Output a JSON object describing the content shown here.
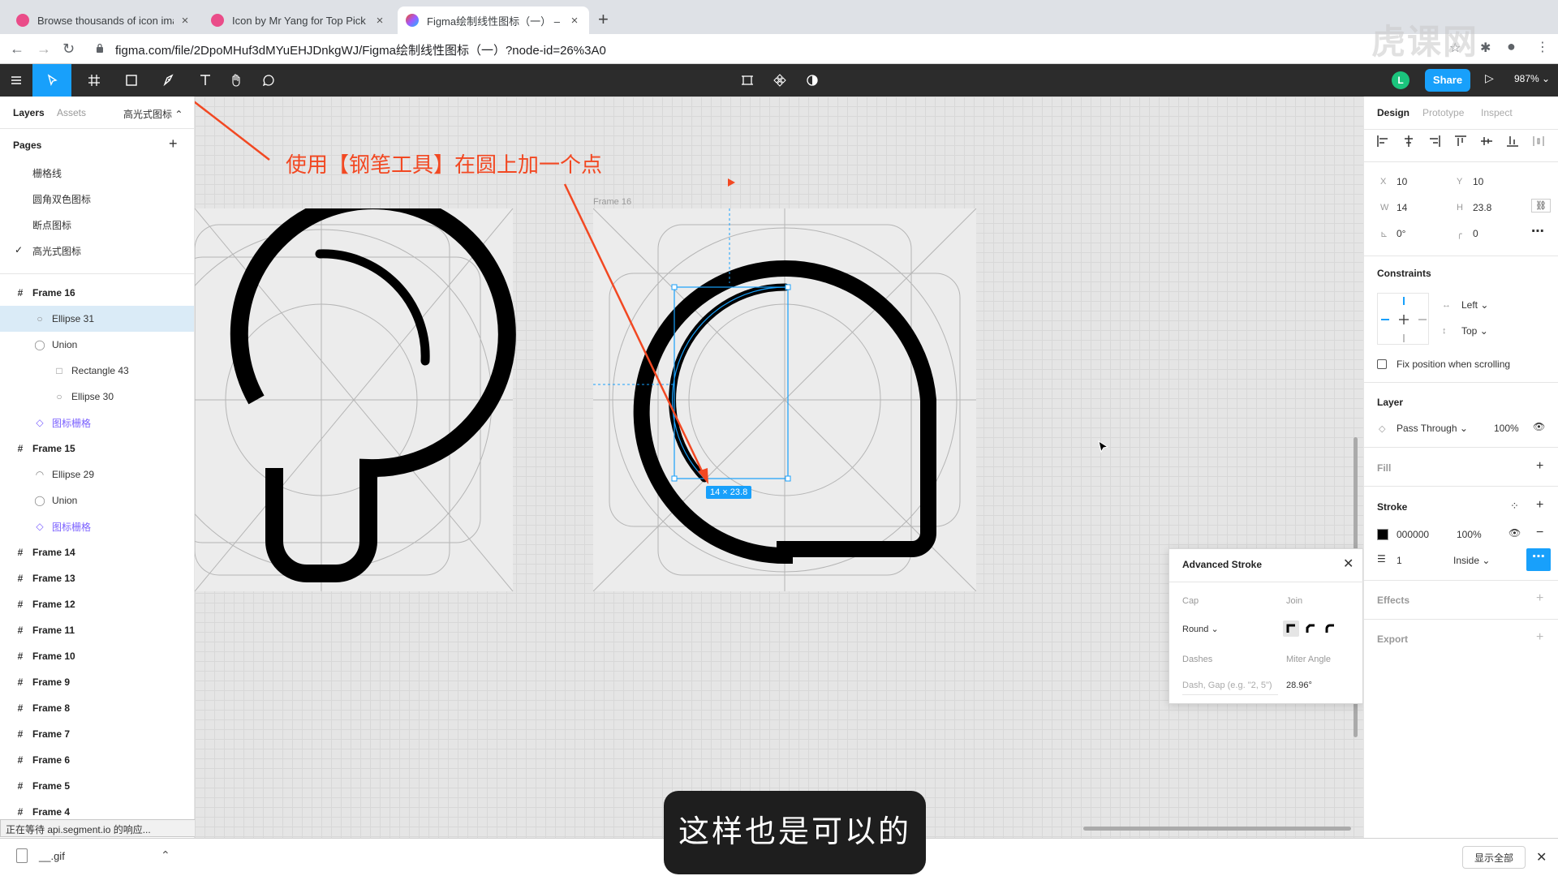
{
  "browser": {
    "tabs": [
      {
        "title": "Browse thousands of icon imag",
        "active": false,
        "favicon_color": "#ea4c89"
      },
      {
        "title": "Icon by Mr Yang for Top Pick S",
        "active": false,
        "favicon_color": "#ea4c89"
      },
      {
        "title": "Figma绘制线性图标（一） – Fig",
        "active": true,
        "favicon_color": "#f24e1e"
      }
    ],
    "url": "figma.com/file/2DpoMHuf3dMYuEHJDnkgWJ/Figma绘制线性图标（一）?node-id=26%3A0",
    "watermark": "虎课网"
  },
  "toolbar": {
    "share_label": "Share",
    "zoom": "987%",
    "avatar_initial": "L"
  },
  "left_panel": {
    "tabs": {
      "layers": "Layers",
      "assets": "Assets"
    },
    "current_page": "高光式图标",
    "pages_header": "Pages",
    "pages": [
      "栅格线",
      "圆角双色图标",
      "断点图标",
      "高光式图标"
    ],
    "layers": [
      {
        "label": "Frame 16",
        "type": "frame",
        "indent": 0
      },
      {
        "label": "Ellipse 31",
        "type": "ellipse",
        "indent": 1,
        "selected": true
      },
      {
        "label": "Union",
        "type": "union",
        "indent": 1
      },
      {
        "label": "Rectangle 43",
        "type": "rect",
        "indent": 2
      },
      {
        "label": "Ellipse 30",
        "type": "ellipse",
        "indent": 2
      },
      {
        "label": "图标栅格",
        "type": "component",
        "indent": 1
      },
      {
        "label": "Frame 15",
        "type": "frame",
        "indent": 0
      },
      {
        "label": "Ellipse 29",
        "type": "arc",
        "indent": 1
      },
      {
        "label": "Union",
        "type": "union",
        "indent": 1
      },
      {
        "label": "图标栅格",
        "type": "component",
        "indent": 1
      },
      {
        "label": "Frame 14",
        "type": "frame",
        "indent": 0
      },
      {
        "label": "Frame 13",
        "type": "frame",
        "indent": 0
      },
      {
        "label": "Frame 12",
        "type": "frame",
        "indent": 0
      },
      {
        "label": "Frame 11",
        "type": "frame",
        "indent": 0
      },
      {
        "label": "Frame 10",
        "type": "frame",
        "indent": 0
      },
      {
        "label": "Frame 9",
        "type": "frame",
        "indent": 0
      },
      {
        "label": "Frame 8",
        "type": "frame",
        "indent": 0
      },
      {
        "label": "Frame 7",
        "type": "frame",
        "indent": 0
      },
      {
        "label": "Frame 6",
        "type": "frame",
        "indent": 0
      },
      {
        "label": "Frame 5",
        "type": "frame",
        "indent": 0
      },
      {
        "label": "Frame 4",
        "type": "frame",
        "indent": 0
      }
    ],
    "status_tip": "正在等待 api.segment.io 的响应..."
  },
  "canvas": {
    "frame_label": "Frame 16",
    "annotation": "使用【钢笔工具】在圆上加一个点",
    "annotation_color": "#f24822",
    "dimension_badge": "14 × 23.8"
  },
  "advanced_stroke": {
    "title": "Advanced Stroke",
    "cap_label": "Cap",
    "cap_value": "Round",
    "join_label": "Join",
    "dashes_label": "Dashes",
    "dashes_placeholder": "Dash, Gap (e.g. \"2, 5\")",
    "miter_label": "Miter Angle",
    "miter_value": "28.96°"
  },
  "right_panel": {
    "tabs": {
      "design": "Design",
      "prototype": "Prototype",
      "inspect": "Inspect"
    },
    "x": "10",
    "y": "10",
    "w": "14",
    "h": "23.8",
    "rotation": "0°",
    "radius": "0",
    "constraints_header": "Constraints",
    "constraint_h": "Left",
    "constraint_v": "Top",
    "fix_position": "Fix position when scrolling",
    "layer_header": "Layer",
    "blend_mode": "Pass Through",
    "layer_opacity": "100%",
    "fill_header": "Fill",
    "stroke_header": "Stroke",
    "stroke_color": "000000",
    "stroke_opacity": "100%",
    "stroke_weight": "1",
    "stroke_align": "Inside",
    "effects_header": "Effects",
    "export_header": "Export"
  },
  "downloads": {
    "file": "__.gif",
    "show_all": "显示全部"
  },
  "subtitle": "这样也是可以的"
}
